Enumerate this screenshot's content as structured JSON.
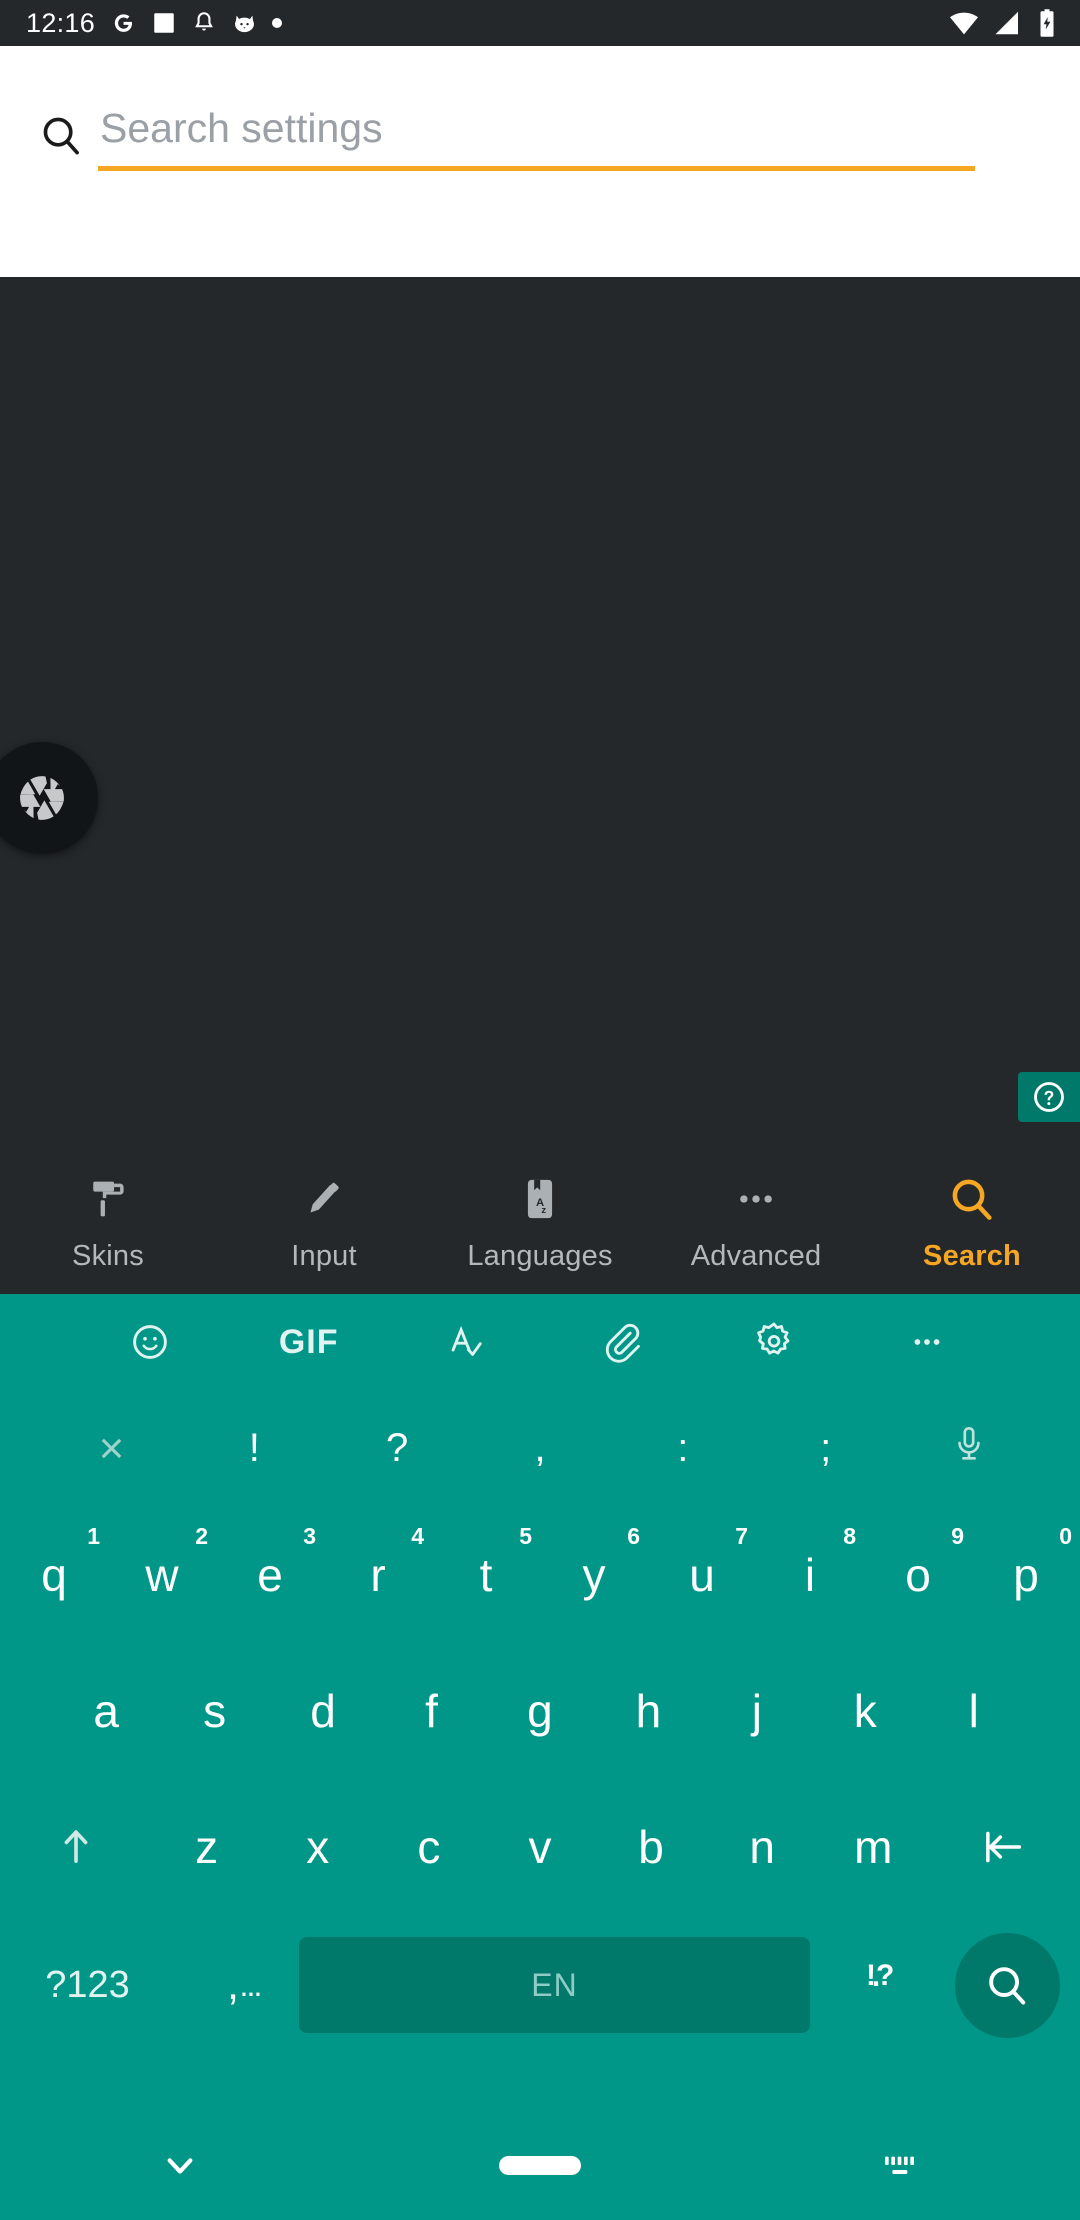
{
  "status_bar": {
    "time": "12:16",
    "left_icons": [
      "google-icon",
      "image-icon",
      "bell-icon",
      "cat-icon",
      "dot-icon"
    ],
    "right_icons": [
      "wifi-icon",
      "signal-icon",
      "battery-charging-icon"
    ],
    "background_color": "#24282b"
  },
  "search": {
    "placeholder": "Search settings",
    "value": "",
    "icon": "search-icon",
    "underline_color": "#f5a623",
    "background_color": "#ffffff"
  },
  "overlay": {
    "capture_button_icon": "aperture-icon",
    "help_button_icon": "help-circle-icon",
    "help_background": "#00796b"
  },
  "bottom_nav": {
    "active": "Search",
    "active_color": "#f5a623",
    "inactive_color": "#b3b8bb",
    "items": [
      {
        "label": "Skins",
        "icon": "paint-roller-icon"
      },
      {
        "label": "Input",
        "icon": "pencil-icon"
      },
      {
        "label": "Languages",
        "icon": "book-az-icon"
      },
      {
        "label": "Advanced",
        "icon": "more-horizontal-icon"
      },
      {
        "label": "Search",
        "icon": "search-icon"
      }
    ]
  },
  "keyboard": {
    "background_color": "#009688",
    "key_accent_color": "#00796b",
    "toolbar": [
      {
        "label": "",
        "icon": "emoji-icon"
      },
      {
        "label": "GIF",
        "icon": "gif-icon"
      },
      {
        "label": "",
        "icon": "spellcheck-icon"
      },
      {
        "label": "",
        "icon": "paperclip-icon"
      },
      {
        "label": "",
        "icon": "gear-icon"
      },
      {
        "label": "",
        "icon": "more-horizontal-icon"
      }
    ],
    "suggestions": [
      "×",
      "!",
      "?",
      ",",
      ":",
      ";"
    ],
    "mic_icon": "microphone-icon",
    "row1": [
      {
        "key": "q",
        "hint": "1"
      },
      {
        "key": "w",
        "hint": "2"
      },
      {
        "key": "e",
        "hint": "3"
      },
      {
        "key": "r",
        "hint": "4"
      },
      {
        "key": "t",
        "hint": "5"
      },
      {
        "key": "y",
        "hint": "6"
      },
      {
        "key": "u",
        "hint": "7"
      },
      {
        "key": "i",
        "hint": "8"
      },
      {
        "key": "o",
        "hint": "9"
      },
      {
        "key": "p",
        "hint": "0"
      }
    ],
    "row2": [
      "a",
      "s",
      "d",
      "f",
      "g",
      "h",
      "j",
      "k",
      "l"
    ],
    "row3": {
      "shift_icon": "shift-arrow-up-icon",
      "keys": [
        "z",
        "x",
        "c",
        "v",
        "b",
        "n",
        "m"
      ],
      "backspace_icon": "backspace-icon"
    },
    "row4": {
      "symbols_label": "?123",
      "comma_label": ",",
      "comma_hint": "…",
      "space_label": "EN",
      "period_label": ".",
      "period_hint": "!?",
      "enter_icon": "search-icon"
    }
  },
  "nav_bar": {
    "back_icon": "chevron-down-icon",
    "home_icon": "home-pill-icon",
    "keyboard_switch_icon": "keyboard-switch-icon",
    "background_color": "#009688"
  }
}
